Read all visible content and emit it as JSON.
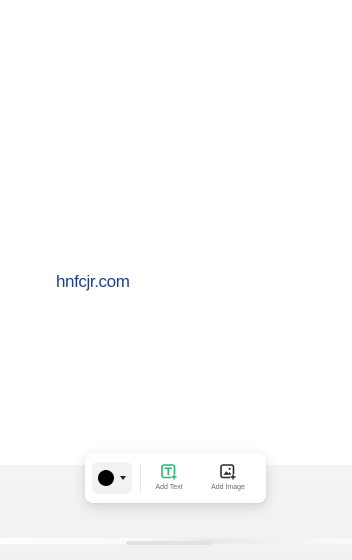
{
  "canvas": {
    "text_element": "hnfcjr.com",
    "text_color": "#1d3f8f"
  },
  "toolbar": {
    "color_picker": {
      "selected_color": "#000000",
      "icon": "chevron-down-icon"
    },
    "add_text": {
      "label": "Add Text",
      "icon": "add-text-icon",
      "accent": "#2bb673"
    },
    "add_image": {
      "label": "Add Image",
      "icon": "add-image-icon"
    }
  }
}
